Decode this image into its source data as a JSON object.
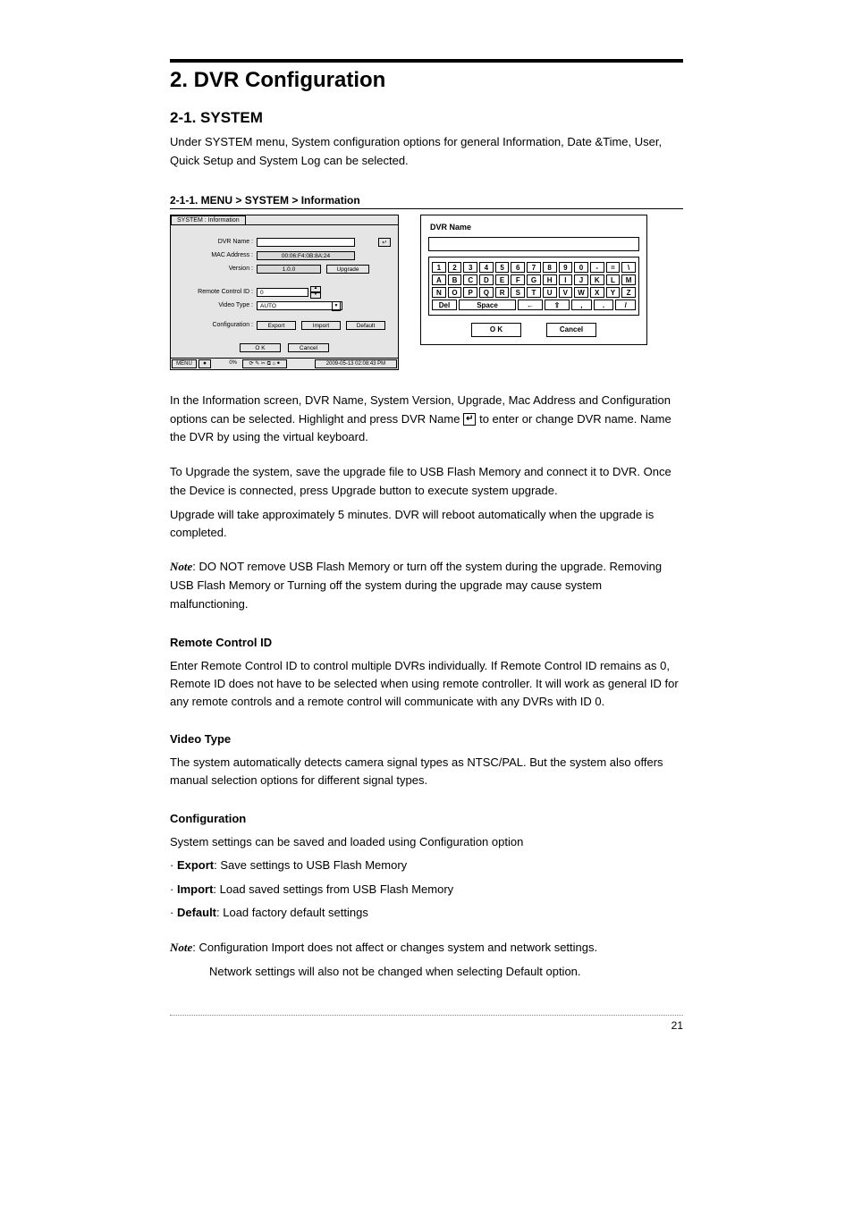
{
  "header": {
    "title": "2. DVR Configuration"
  },
  "section": {
    "title": "2-1. SYSTEM",
    "intro": "Under SYSTEM menu, System configuration options for general Information, Date &Time, User, Quick Setup and System Log can be selected."
  },
  "subsection": {
    "title": "2-1-1. MENU > SYSTEM > Information"
  },
  "info_win": {
    "tab": "SYSTEM : Information",
    "labels": {
      "dvr_name": "DVR Name :",
      "mac": "MAC Address :",
      "version": "Version :",
      "remote": "Remote Control ID :",
      "video": "Video Type :",
      "config": "Configuration :"
    },
    "values": {
      "dvr_name": "",
      "mac": "00:06:F4:0B:8A:24",
      "version": "1.0.0",
      "remote": "0",
      "video": "AUTO"
    },
    "buttons": {
      "enter": "↵",
      "upgrade": "Upgrade",
      "export": "Export",
      "import": "Import",
      "default": "Default",
      "ok": "O K",
      "cancel": "Cancel"
    },
    "status": {
      "menu": "MENU",
      "pct": "0%",
      "icons": "⟳ ✎ ✂ ⧉ ⌂ ⏺",
      "time": "2009-05-13  02:08:43 PM"
    }
  },
  "keyboard": {
    "title": "DVR Name",
    "row1": [
      "1",
      "2",
      "3",
      "4",
      "5",
      "6",
      "7",
      "8",
      "9",
      "0",
      "-",
      "=",
      "\\"
    ],
    "row2": [
      "A",
      "B",
      "C",
      "D",
      "E",
      "F",
      "G",
      "H",
      "I",
      "J",
      "K",
      "L",
      "M"
    ],
    "row3": [
      "N",
      "O",
      "P",
      "Q",
      "R",
      "S",
      "T",
      "U",
      "V",
      "W",
      "X",
      "Y",
      "Z"
    ],
    "row4": {
      "del": "Del",
      "space": "Space",
      "back": "←",
      "shift": "⇧",
      "comma": ",",
      "dot": ".",
      "slash": "/"
    },
    "ok": "O K",
    "cancel": "Cancel"
  },
  "body": {
    "p1a": "In the Information screen, DVR Name, System Version, Upgrade, Mac Address and Configuration options can be selected. Highlight and press DVR Name ",
    "p1b": " to enter or change DVR name. Name the DVR by using the virtual keyboard.",
    "p2": "To Upgrade the system, save the upgrade file to USB Flash Memory and connect it to DVR. Once the Device is connected, press Upgrade button to execute system upgrade.",
    "p3": "Upgrade will take approximately 5 minutes. DVR will reboot automatically when the upgrade is completed.",
    "note1_label": "Note",
    "note1_text": ": DO NOT remove USB Flash Memory or turn off the system during the upgrade. Removing USB Flash Memory or Turning off the system during the upgrade may cause system malfunctioning.",
    "remote_h": "Remote Control ID",
    "remote_p": "Enter Remote Control ID to control multiple DVRs individually. If Remote Control ID remains as 0, Remote ID does not have to be selected when using remote controller. It will work as general ID for any remote controls and a remote control will communicate with any DVRs with ID 0.",
    "video_h": "Video Type",
    "video_p": "The system automatically detects camera signal types as NTSC/PAL. But the system also offers manual selection options for different signal types.",
    "config_h": "Configuration",
    "config_p": "System settings can be saved and loaded using Configuration option",
    "b_export_l": "Export",
    "b_export_t": ": Save settings to USB Flash Memory",
    "b_import_l": "Import",
    "b_import_t": ": Load saved settings from USB Flash Memory",
    "b_default_l": "Default",
    "b_default_t": ": Load factory default settings",
    "note2_label": "Note",
    "note2a": ": Configuration Import does not affect or changes system and network settings.",
    "note2b": "Network settings will also not be changed when selecting Default option."
  },
  "page_number": "21"
}
